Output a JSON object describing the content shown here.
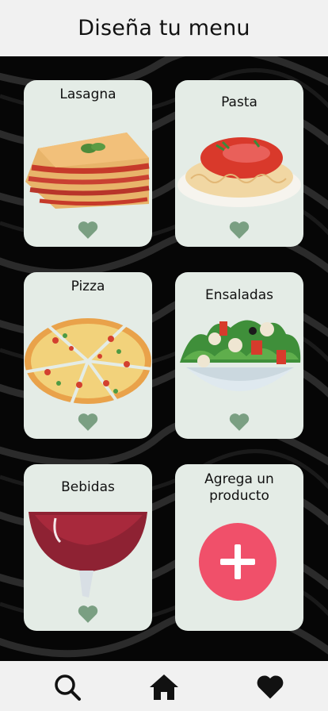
{
  "header": {
    "title": "Diseña tu menu"
  },
  "cards": [
    {
      "label": "Lasagna",
      "icon": "lasagna-image"
    },
    {
      "label": "Pasta",
      "icon": "pasta-image"
    },
    {
      "label": "Pizza",
      "icon": "pizza-image"
    },
    {
      "label": "Ensaladas",
      "icon": "salad-image"
    },
    {
      "label": "Bebidas",
      "icon": "wine-image"
    },
    {
      "label": "Agrega un producto",
      "icon": "plus-icon"
    }
  ],
  "nav": {
    "items": [
      "search-icon",
      "home-icon",
      "heart-icon"
    ]
  },
  "colors": {
    "card_bg": "#e4ece6",
    "heart": "#7a9f82",
    "add_button": "#f0506a",
    "header_bg": "#f1f1f1"
  }
}
